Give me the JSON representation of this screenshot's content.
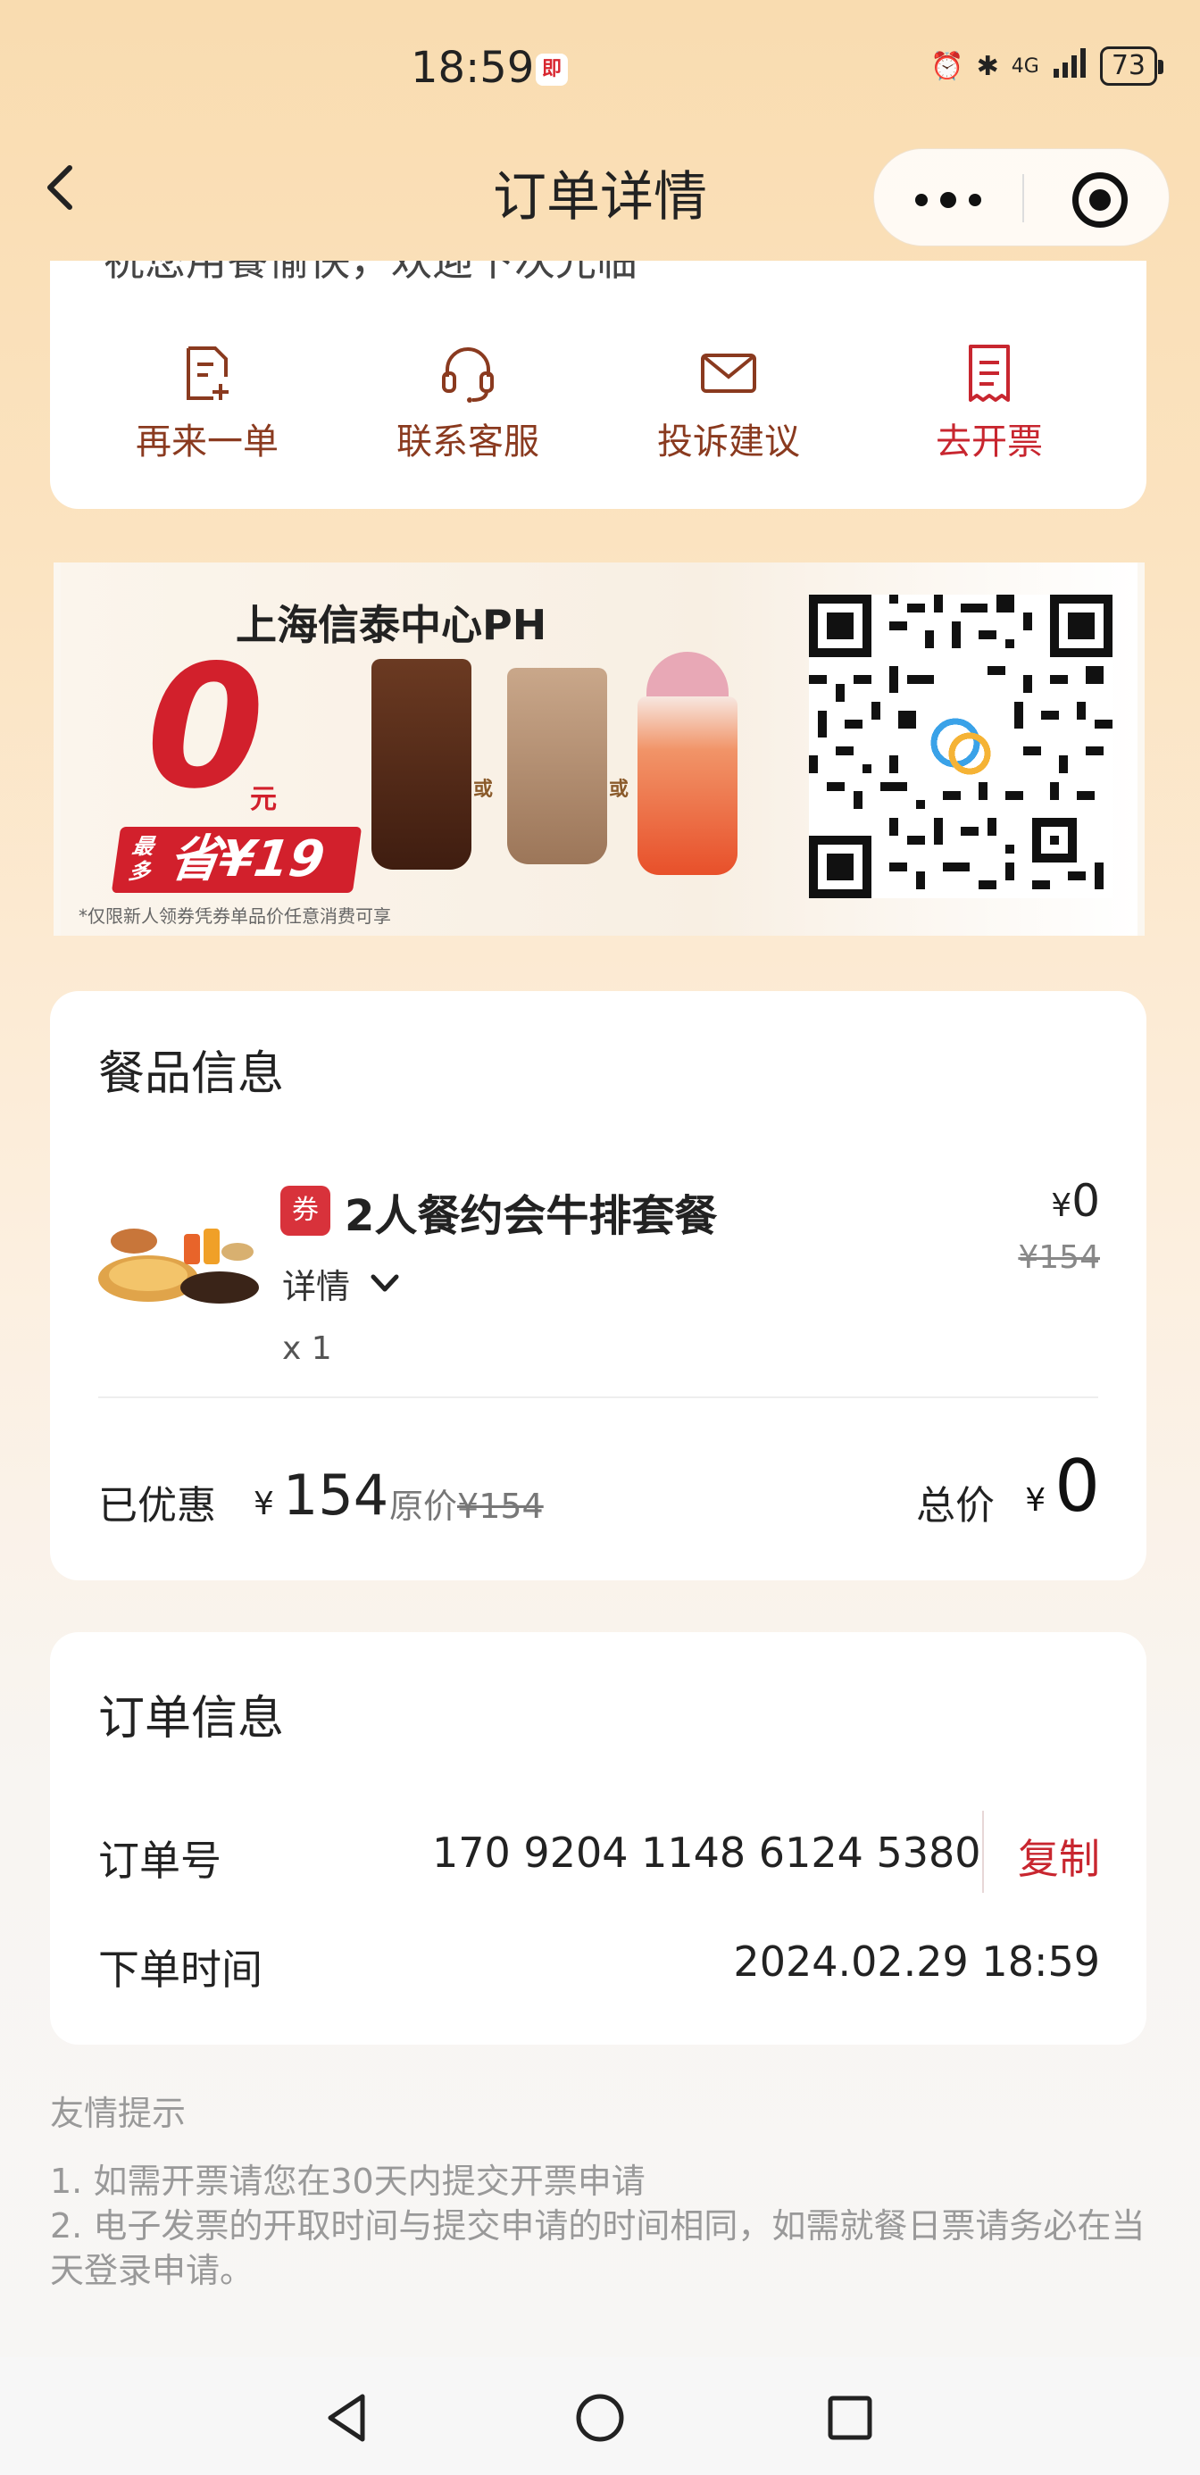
{
  "status_bar": {
    "time": "18:59",
    "app_badge": "即",
    "network": "4G",
    "battery": "73"
  },
  "nav": {
    "title": "订单详情",
    "back_icon": "chevron-left-icon",
    "more_icon": "more-dots-icon",
    "target_icon": "mini-program-target-icon"
  },
  "top_card": {
    "partial_text": "祝您用餐愉快，欢迎下次光临",
    "actions": [
      {
        "label": "再来一单",
        "icon": "reorder-icon"
      },
      {
        "label": "联系客服",
        "icon": "headset-icon"
      },
      {
        "label": "投诉建议",
        "icon": "mail-icon"
      },
      {
        "label": "去开票",
        "icon": "invoice-icon",
        "color": "#c8262f"
      }
    ]
  },
  "banner": {
    "title": "上海信泰中心PH",
    "big_value": "0",
    "unit": "元",
    "save_prefix": "最多",
    "save_text": "省¥19",
    "or_text": "或",
    "note": "*仅限新人领券凭券单品价任意消费可享"
  },
  "meal": {
    "section_title": "餐品信息",
    "coupon_tag": "券",
    "item_name": "2人餐约会牛排套餐",
    "detail_label": "详情",
    "quantity": "x 1",
    "currency": "¥",
    "price": "0",
    "original_price": "¥154",
    "saved_label": "已优惠",
    "saved_amount": "154",
    "orig_label": "原价",
    "orig_value": "¥154",
    "total_label": "总价",
    "total_amount": "0"
  },
  "order": {
    "section_title": "订单信息",
    "order_no_label": "订单号",
    "order_no": "170 9204 1148 6124 5380",
    "copy_label": "复制",
    "time_label": "下单时间",
    "time_value": "2024.02.29 18:59"
  },
  "tips": {
    "title": "友情提示",
    "line1": "1. 如需开票请您在30天内提交开票申请",
    "line2": "2. 电子发票的开取时间与提交申请的时间相同，如需就餐日票请务必在当天登录申请。"
  },
  "colors": {
    "accent_red": "#c8262f",
    "action_brown": "#8a3a1f"
  }
}
